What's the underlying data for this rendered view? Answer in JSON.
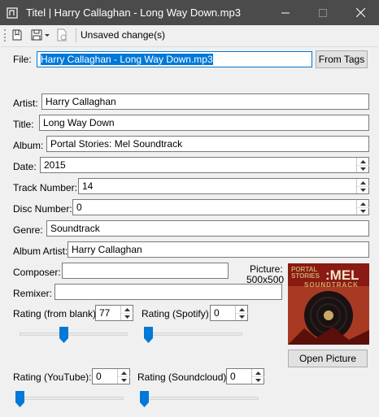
{
  "window": {
    "title": "Titel | Harry Callaghan - Long Way Down.mp3"
  },
  "toolbar": {
    "status_label": "Unsaved change(s)"
  },
  "file": {
    "label": "File:",
    "value": "Harry Callaghan - Long Way Down.mp3",
    "from_tags_button": "From Tags"
  },
  "fields": {
    "artist": {
      "label": "Artist:",
      "value": "Harry Callaghan"
    },
    "title": {
      "label": "Title:",
      "value": "Long Way Down"
    },
    "album": {
      "label": "Album:",
      "value": "Portal Stories: Mel Soundtrack"
    },
    "date": {
      "label": "Date:",
      "value": "2015"
    },
    "track_number": {
      "label": "Track Number:",
      "value": "14"
    },
    "disc_number": {
      "label": "Disc Number:",
      "value": "0"
    },
    "genre": {
      "label": "Genre:",
      "value": "Soundtrack"
    },
    "album_artist": {
      "label": "Album Artist:",
      "value": "Harry Callaghan"
    },
    "composer": {
      "label": "Composer:",
      "value": ""
    },
    "remixer": {
      "label": "Remixer:",
      "value": ""
    }
  },
  "picture": {
    "label": "Picture:",
    "dimensions": "500x500",
    "open_button": "Open Picture",
    "art_text_top": "PORTAL",
    "art_text_mid": "STORIES",
    "art_text_mel": ":MEL",
    "art_text_sub": "SOUNDTRACK"
  },
  "ratings": {
    "from_blank": {
      "label": "Rating (from blank):",
      "value": "77",
      "slider_fraction": 0.41
    },
    "spotify": {
      "label": "Rating (Spotify):",
      "value": "0",
      "slider_fraction": 0.0
    },
    "youtube": {
      "label": "Rating (YouTube):",
      "value": "0",
      "slider_fraction": 0.0
    },
    "soundcloud": {
      "label": "Rating (Soundcloud):",
      "value": "0",
      "slider_fraction": 0.0
    }
  },
  "colors": {
    "titlebar": "#4b4b4b",
    "accent": "#0078d7",
    "album_art_bg": "#8a1a14",
    "album_art_gold": "#c9a867"
  }
}
